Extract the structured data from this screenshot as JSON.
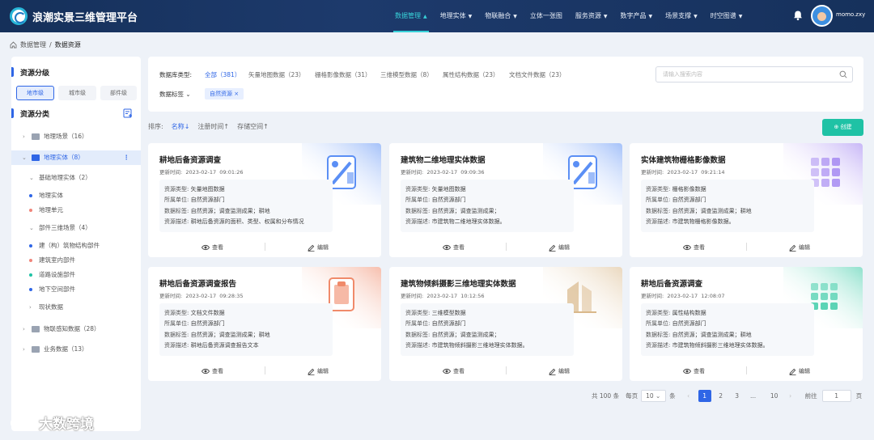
{
  "app": {
    "title": "浪潮实景三维管理平台",
    "username": "momo.zxy"
  },
  "nav": [
    "数据管理",
    "地理实体",
    "物联融合",
    "立体一张图",
    "服务资源",
    "数字产品",
    "场景支撑",
    "时空图谱"
  ],
  "breadcrumb": {
    "home": "数据管理",
    "sep": "/",
    "current": "数据资源"
  },
  "sidebar": {
    "level_title": "资源分级",
    "levels": [
      "地市级",
      "城市级",
      "部件级"
    ],
    "category_title": "资源分类",
    "tree": [
      {
        "label": "地理场景（16）"
      },
      {
        "label": "地理实体（8）"
      },
      {
        "label": "基础地理实体（2）"
      },
      {
        "label": "地理实体"
      },
      {
        "label": "地理单元"
      },
      {
        "label": "部件三维场景（4）"
      },
      {
        "label": "建（构）筑物结构部件"
      },
      {
        "label": "建筑室内部件"
      },
      {
        "label": "道路设施部件"
      },
      {
        "label": "地下空间部件"
      },
      {
        "label": "现状数据"
      },
      {
        "label": "物联感知数据（28）"
      },
      {
        "label": "业务数据（13）"
      }
    ]
  },
  "filter": {
    "type_label": "数据库类型:",
    "types": [
      "全部（381）",
      "矢量地图数据（23）",
      "栅格影像数据（31）",
      "三维模型数据（8）",
      "属性结构数据（23）",
      "文档文件数据（23）"
    ],
    "tag_label": "数据标签",
    "tag": "自然资源",
    "search_placeholder": "请输入搜索内容"
  },
  "sort": {
    "label": "排序:",
    "options": [
      "名称↓",
      "注册时间↑",
      "存储空间↑"
    ],
    "create": "创建"
  },
  "card_labels": {
    "updated": "更新时间:",
    "type": "资源类型:",
    "unit": "所属单位:",
    "tags": "数据标签:",
    "desc": "资源描述:",
    "view": "查看",
    "edit": "编辑"
  },
  "cards": [
    {
      "title": "耕地后备资源调查",
      "date": "2023-02-17",
      "time": "09:01:26",
      "type": "矢量地图数据",
      "unit": "自然资源部门",
      "tags": "自然资源；调查监测成果；耕地",
      "desc": "耕地后备资源的面积、类型、权属和分布情况",
      "color": "#5b8ff5"
    },
    {
      "title": "建筑物二维地理实体数据",
      "date": "2023-02-17",
      "time": "09:09:36",
      "type": "矢量地图数据",
      "unit": "自然资源部门",
      "tags": "自然资源；调查监测成果；",
      "desc": "市建筑物二维地理实体数据。",
      "color": "#5b8ff5"
    },
    {
      "title": "实体建筑物栅格影像数据",
      "date": "2023-02-17",
      "time": "09:21:14",
      "type": "栅格影像数据",
      "unit": "自然资源部门",
      "tags": "自然资源；调查监测成果；耕地",
      "desc": "市建筑物栅格影像数据。",
      "color": "#9b7cf0"
    },
    {
      "title": "耕地后备资源调查报告",
      "date": "2023-02-17",
      "time": "09:28:35",
      "type": "文档文件数据",
      "unit": "自然资源部门",
      "tags": "自然资源；调查监测成果；耕地",
      "desc": "耕地后备资源调查报告文本",
      "color": "#f08a6a"
    },
    {
      "title": "建筑物倾斜摄影三维地理实体数据",
      "date": "2023-02-17",
      "time": "10:12:56",
      "type": "三维模型数据",
      "unit": "自然资源部门",
      "tags": "自然资源；调查监测成果；",
      "desc": "市建筑物倾斜摄影三维地理实体数据。",
      "color": "#d9b88a"
    },
    {
      "title": "耕地后备资源调查",
      "date": "2023-02-17",
      "time": "12:08:07",
      "type": "属性结构数据",
      "unit": "自然资源部门",
      "tags": "自然资源；调查监测成果；耕地",
      "desc": "市建筑物倾斜摄影三维地理实体数据。",
      "color": "#35c9a4"
    }
  ],
  "pagination": {
    "total": "共 100 条",
    "per_page_label": "每页",
    "per_page": "10",
    "unit": "条",
    "prev": "‹",
    "pages": [
      "1",
      "2",
      "3",
      "...",
      "10"
    ],
    "next": "›",
    "goto": "前往",
    "goto_value": "1",
    "page_unit": "页"
  },
  "watermark": "大数跨境"
}
